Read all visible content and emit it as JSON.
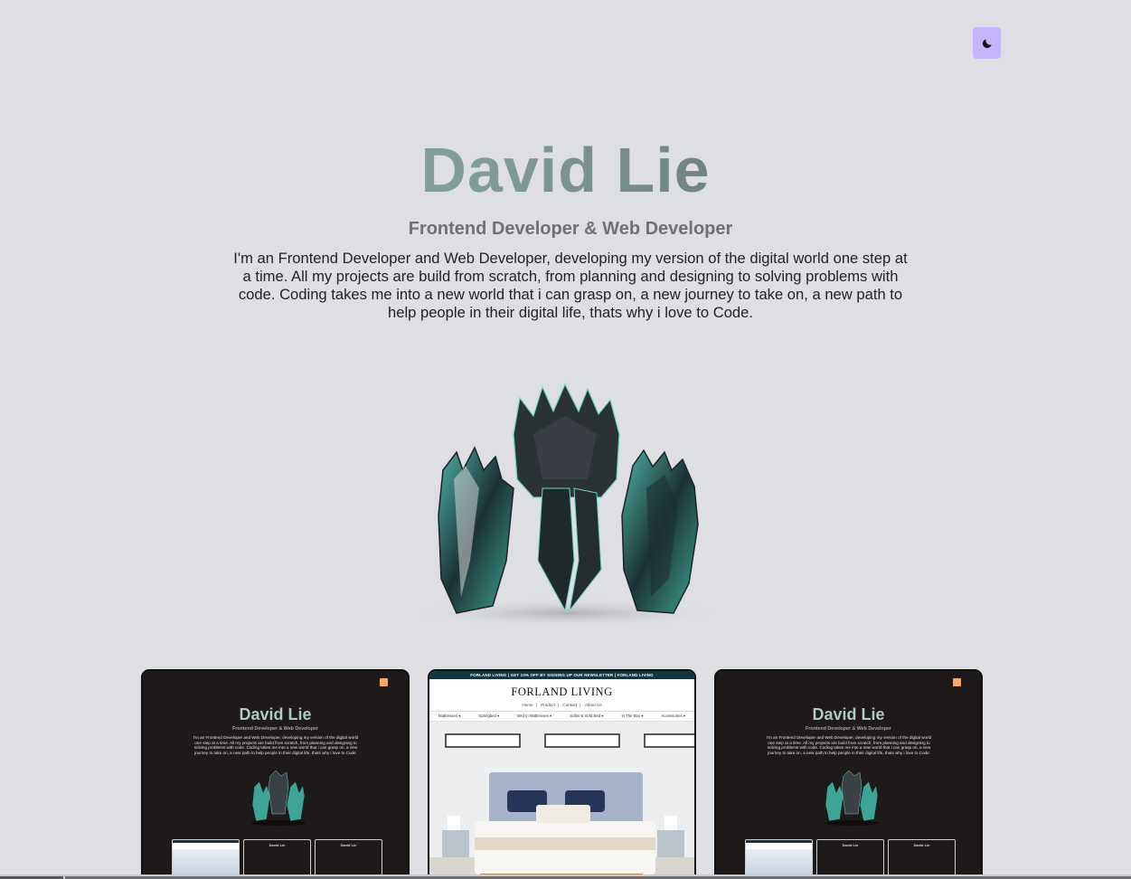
{
  "theme_toggle": {
    "icon": "moon-icon"
  },
  "hero": {
    "name_first": "David",
    "name_last": "Lie",
    "subtitle": "Frontend Developer & Web Developer",
    "bio": "I'm an Frontend Developer and Web Developer, developing my version of the digital world one step at a time. All my projects are build from scratch, from planning and designing to solving problems with code. Coding takes me into a new world that i can grasp on, a new journey to take on, a new path to help people in their digital life, thats why i love to Code.",
    "figure": "crystal-golem-3d-model"
  },
  "projects": [
    {
      "name": "David Lie",
      "subtitle": "Frontend Developer & Web Developer",
      "bio": "I'm an Frontend Developer and Web Developer, developing my version of the digital world one step at a time. All my projects are build from scratch, from planning and designing to solving problems with code. Coding takes me into a new world that i can grasp on, a new journey to take on, a new path to help people in their digital life, thats why i love to Code."
    },
    {
      "banner": "FORLAND LIVING | GET 10% OFF BY SIGNING UP OUR NEWSLETTER | FORLAND LIVING",
      "brand": "FORLAND LIVING",
      "nav_top": [
        "Home",
        "Product",
        "Contact",
        "About Us"
      ],
      "nav_categories": [
        "Mattresses ▾",
        "Springbed ▾",
        "Bed In Mattresses ▾",
        "Sofas & Sofa Bed ▾",
        "In The Box ▾",
        "Accessories ▾"
      ]
    },
    {
      "name": "David Lie",
      "subtitle": "Frontend Developer & Web Developer",
      "bio": "I'm an Frontend Developer and Web Developer, developing my version of the digital world one step at a time. All my projects are build from scratch, from planning and designing to solving problems with code. Coding takes me into a new world that i can grasp on, a new journey to take on, a new path to help people in their digital life, thats why i love to Code."
    }
  ],
  "colors": {
    "background": "#dedfe3",
    "toggle": "#c4b5fd",
    "card_dark": "#1d1a19",
    "banner": "#12363f"
  }
}
